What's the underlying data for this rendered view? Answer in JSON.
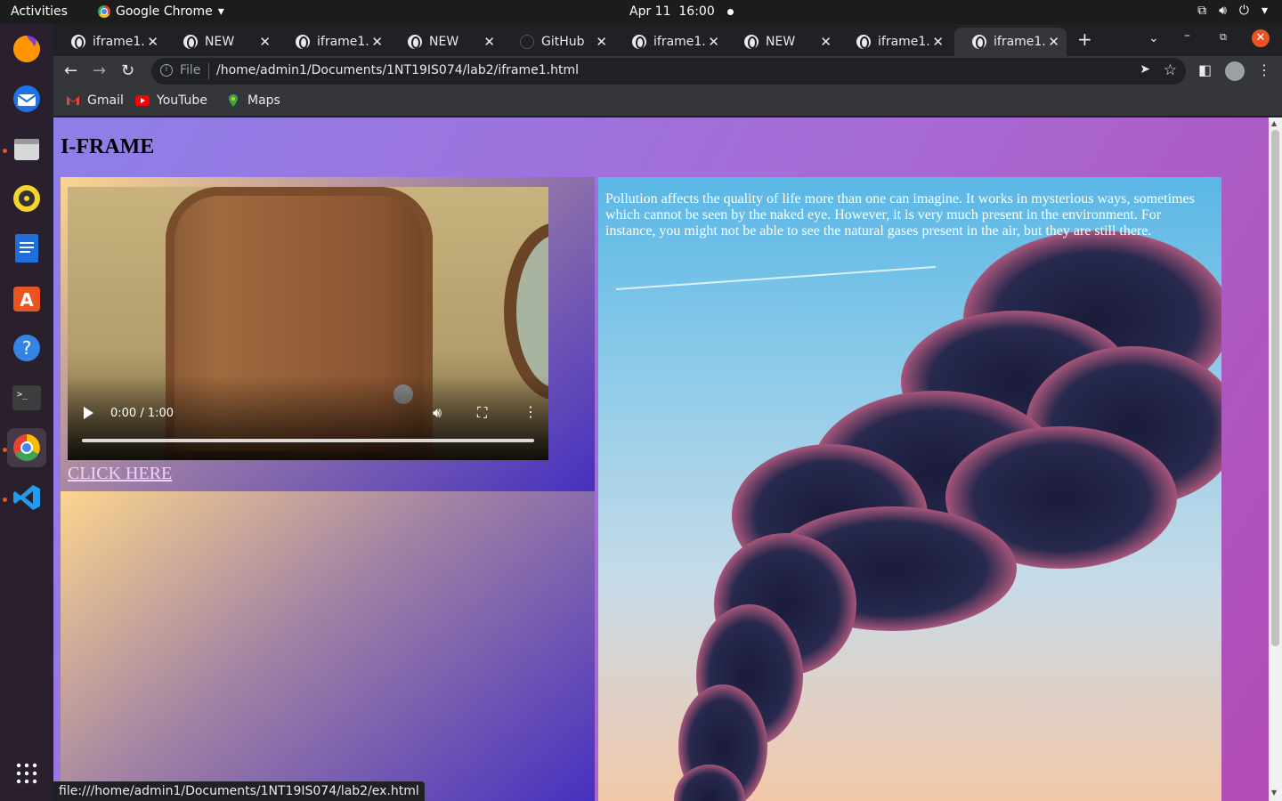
{
  "topbar": {
    "activities": "Activities",
    "app_name": "Google Chrome",
    "date": "Apr 11",
    "time": "16:00"
  },
  "dock": {
    "items": [
      "firefox-icon",
      "thunderbird-icon",
      "files-icon",
      "rhythmbox-icon",
      "writer-icon",
      "software-icon",
      "help-icon",
      "terminal-icon",
      "chrome-icon",
      "vscode-icon",
      "app-grid-icon"
    ]
  },
  "tabs": [
    {
      "title": "iframe1.h",
      "active": false
    },
    {
      "title": "NEW",
      "active": false
    },
    {
      "title": "iframe1.h",
      "active": false
    },
    {
      "title": "NEW",
      "active": false
    },
    {
      "title": "GitHub",
      "active": false
    },
    {
      "title": "iframe1.h",
      "active": false
    },
    {
      "title": "NEW",
      "active": false
    },
    {
      "title": "iframe1.h",
      "active": false
    },
    {
      "title": "iframe1.h",
      "active": true
    }
  ],
  "omnibox": {
    "scheme": "File",
    "url": "/home/admin1/Documents/1NT19IS074/lab2/iframe1.html"
  },
  "bookmarks": [
    {
      "label": "Gmail",
      "color": "#ea4335"
    },
    {
      "label": "YouTube",
      "color": "#ff0000"
    },
    {
      "label": "Maps",
      "color": "#34a853"
    }
  ],
  "page": {
    "heading": "I-FRAME",
    "video": {
      "time": "0:00 / 1:00",
      "progress": 0
    },
    "link": "CLICK HERE",
    "paragraph": "Pollution affects the quality of life more than one can imagine. It works in mysterious ways, sometimes which cannot be seen by the naked eye. However, it is very much present in the environment. For instance, you might not be able to see the natural gases present in the air, but they are still there."
  },
  "status_url": "file:///home/admin1/Documents/1NT19IS074/lab2/ex.html"
}
